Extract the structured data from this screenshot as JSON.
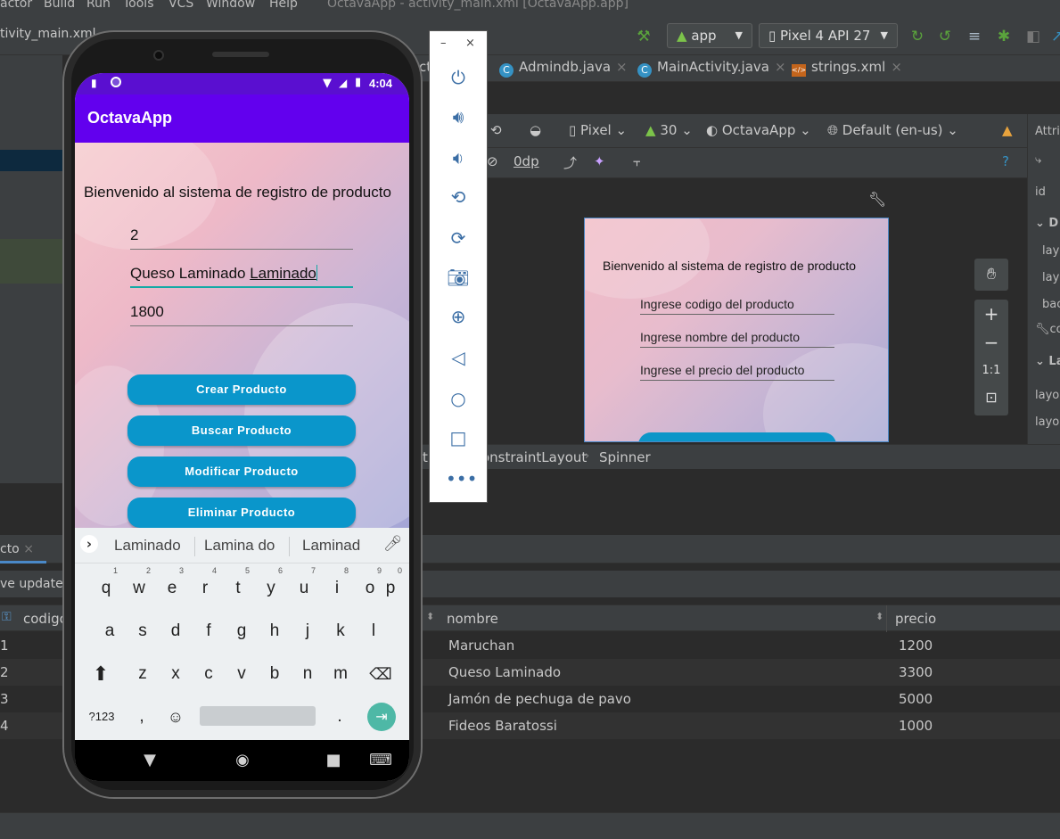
{
  "menu": {
    "items": [
      "actor",
      "Build",
      "Run",
      "Tools",
      "VCS",
      "Window",
      "Help"
    ],
    "window_title": "OctavaApp - activity_main.xml [OctavaApp.app]"
  },
  "toolbar": {
    "file_tab_left": "tivity_main.xml",
    "run_config": "app",
    "device": "Pixel 4 API 27"
  },
  "editor_tabs": [
    {
      "label": "ct",
      "icon": "none"
    },
    {
      "label": "Admindb.java",
      "icon": "class-icon"
    },
    {
      "label": "MainActivity.java",
      "icon": "class-icon"
    },
    {
      "label": "strings.xml",
      "icon": "xml-icon"
    }
  ],
  "design": {
    "device_label": "Pixel",
    "api_level": "30",
    "theme": "OctavaApp",
    "locale": "Default (en-us)",
    "margin": "0dp",
    "attributes_header": "Attrib",
    "attr_id": "id",
    "attr_section_d": "D",
    "attr_rows": [
      "layo",
      "layo",
      "bac"
    ],
    "attr_const": "co",
    "attr_section_l": "La",
    "attr_rows2": [
      "layou",
      "layou"
    ],
    "zoom_reset": "1:1"
  },
  "preview": {
    "title": "Bienvenido al sistema de registro de producto",
    "hint_code": "Ingrese codigo del producto",
    "hint_name": "Ingrese nombre del producto",
    "hint_price": "Ingrese el precio del producto"
  },
  "breadcrumb": {
    "prefix": "t",
    "layout": "onstraintLayout",
    "component": "Spinner"
  },
  "bottom_panel": {
    "tab_label": "cto",
    "updates_label": "ve updates",
    "col_codigo": "codigo",
    "col_nombre": "nombre",
    "col_precio": "precio",
    "rows": [
      {
        "codigo": "1",
        "nombre": "Maruchan",
        "precio": "1200"
      },
      {
        "codigo": "2",
        "nombre": "Queso Laminado",
        "precio": "3300"
      },
      {
        "codigo": "3",
        "nombre": "Jamón de pechuga de pavo",
        "precio": "5000"
      },
      {
        "codigo": "4",
        "nombre": "Fideos Baratossi",
        "precio": "1000"
      }
    ]
  },
  "phone": {
    "time": "4:04",
    "app_title": "OctavaApp",
    "welcome": "Bienvenido al sistema de registro de producto",
    "field_code": "2",
    "field_name_prefix": "Queso Laminado ",
    "field_name_composing": "Laminado",
    "field_price": "1800",
    "btn_create": "Crear Producto",
    "btn_search": "Buscar Producto",
    "btn_modify": "Modificar Producto",
    "btn_delete": "Eliminar Producto"
  },
  "keyboard": {
    "suggestions": [
      "Laminado",
      "Lamina do",
      "Laminad"
    ],
    "row1": [
      {
        "k": "q",
        "n": "1"
      },
      {
        "k": "w",
        "n": "2"
      },
      {
        "k": "e",
        "n": "3"
      },
      {
        "k": "r",
        "n": "4"
      },
      {
        "k": "t",
        "n": "5"
      },
      {
        "k": "y",
        "n": "6"
      },
      {
        "k": "u",
        "n": "7"
      },
      {
        "k": "i",
        "n": "8"
      },
      {
        "k": "o",
        "n": "9"
      },
      {
        "k": "p",
        "n": "0"
      }
    ],
    "row2": [
      "a",
      "s",
      "d",
      "f",
      "g",
      "h",
      "j",
      "k",
      "l"
    ],
    "row3": [
      "z",
      "x",
      "c",
      "v",
      "b",
      "n",
      "m"
    ],
    "symbols_key": "?123",
    "comma": ",",
    "period": "."
  },
  "colors": {
    "app_bar": "#6200ee",
    "status_bar": "#5a0fd0",
    "button": "#0a96cb",
    "ide_bg": "#2b2b2b"
  }
}
